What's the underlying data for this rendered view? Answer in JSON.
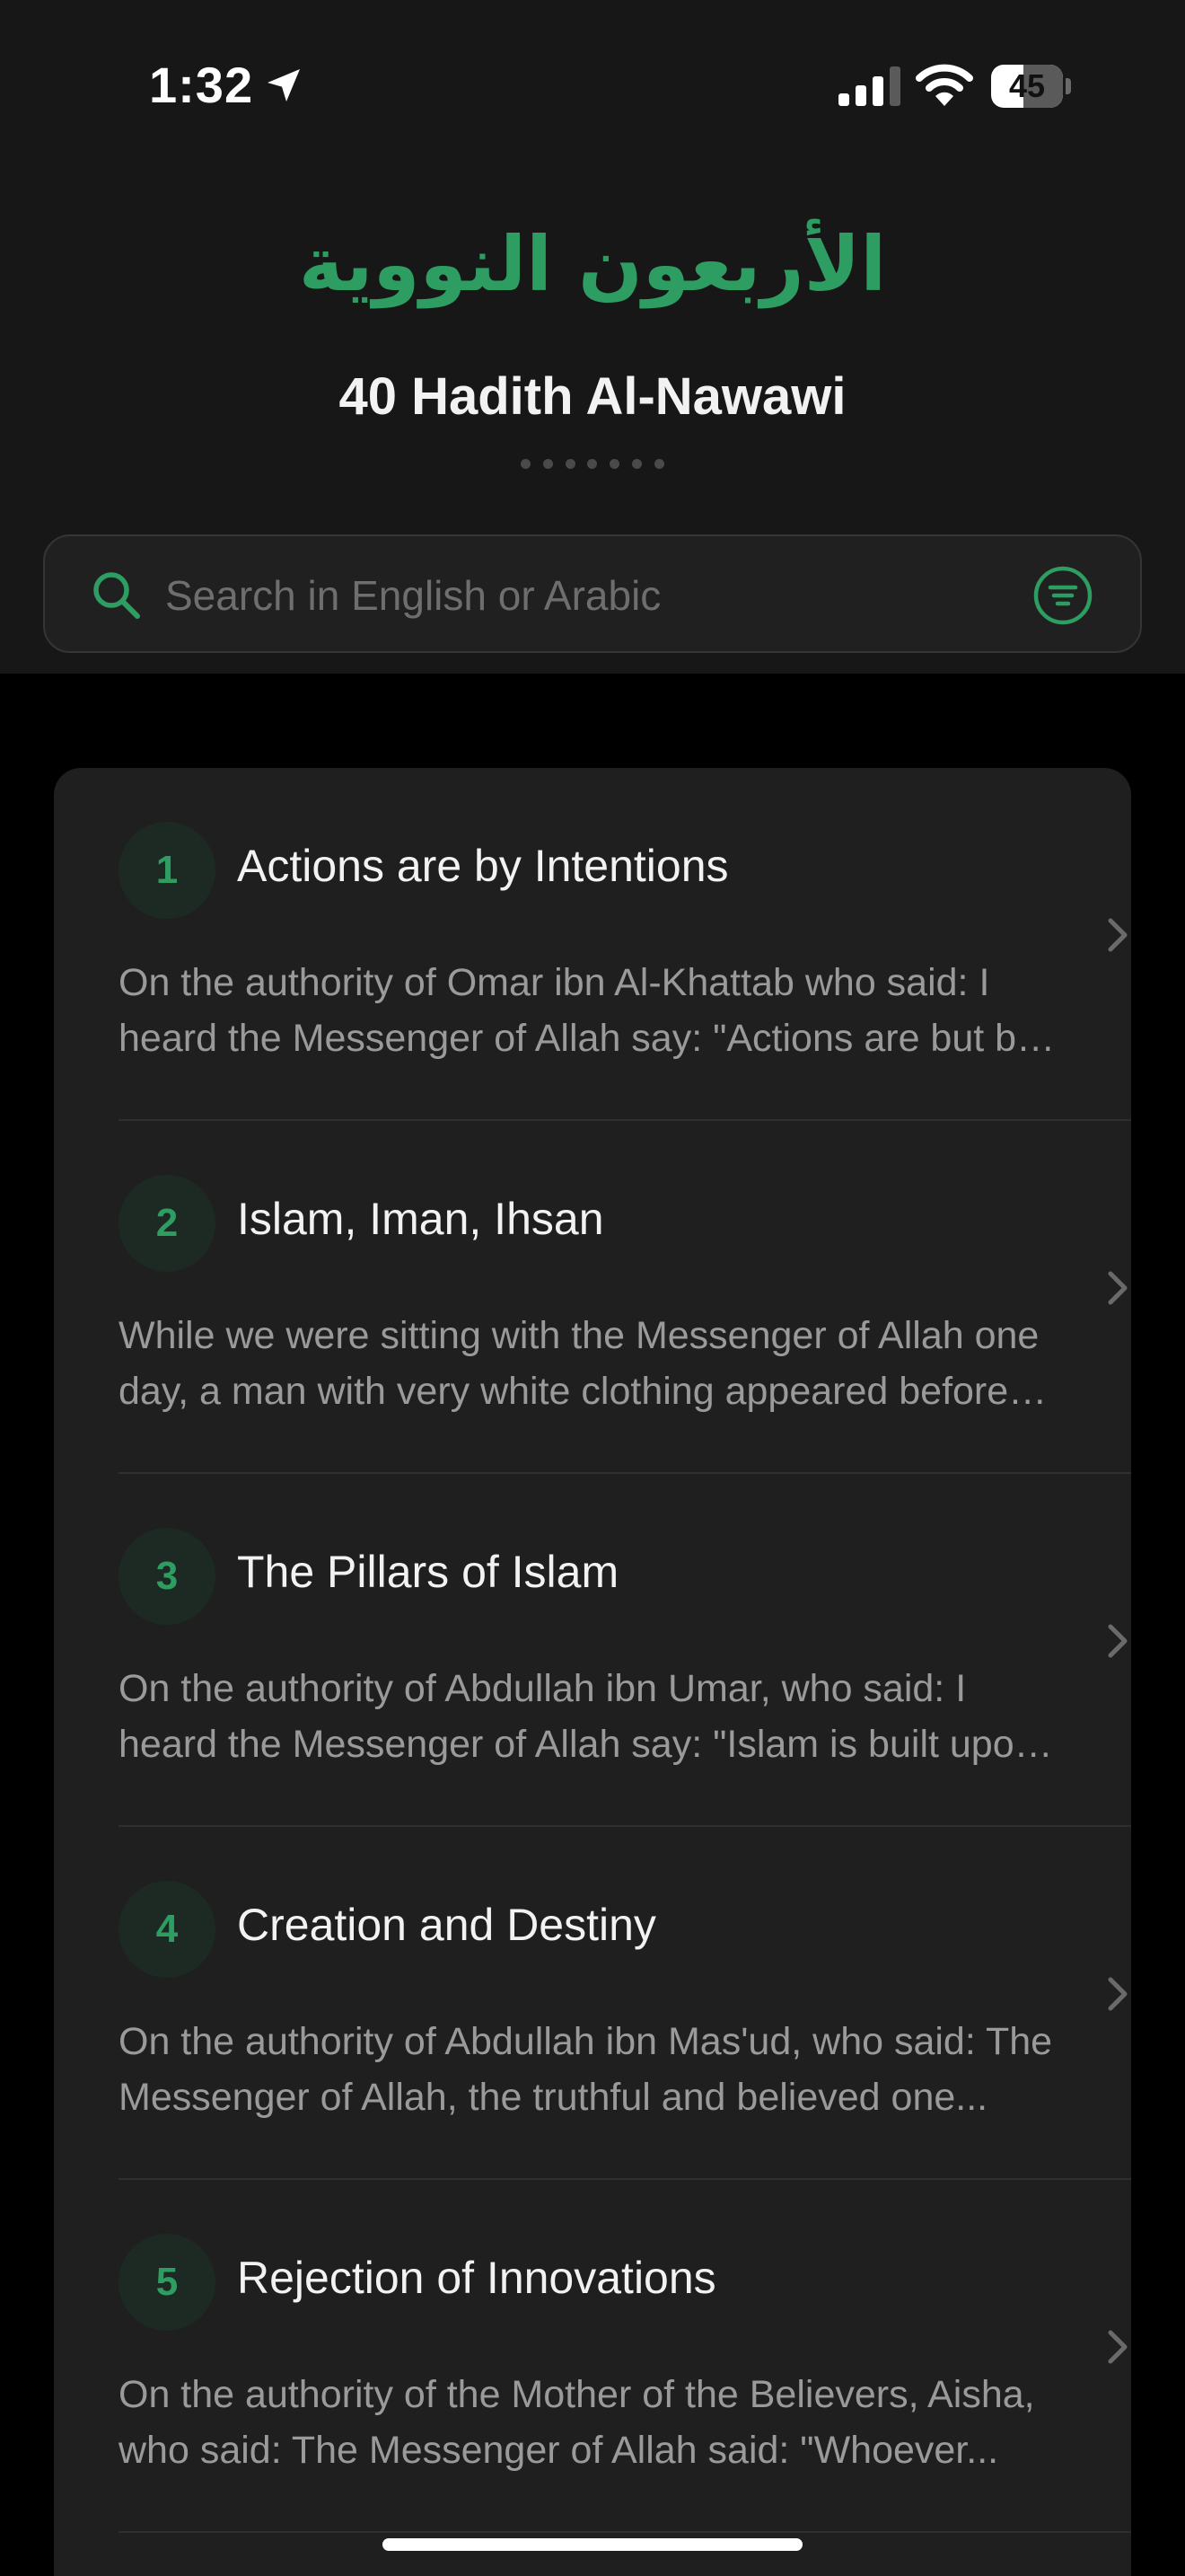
{
  "status_bar": {
    "time": "1:32",
    "battery": "45",
    "battery_level": 0.45
  },
  "header": {
    "arabic_title": "الأربعون النووية",
    "title": "40 Hadith Al-Nawawi",
    "page_dots_count": 7
  },
  "search": {
    "placeholder": "Search in English or Arabic",
    "value": ""
  },
  "icons": {
    "location": "location-arrow-icon",
    "signal": "cellular-signal-icon",
    "wifi": "wifi-icon",
    "search": "search-icon",
    "filter": "filter-icon",
    "chevron": "chevron-right-icon"
  },
  "colors": {
    "accent": "#2e9d62",
    "background": "#000000",
    "header_bg": "#171717",
    "card_bg": "#1f1f1f"
  },
  "hadiths": [
    {
      "number": "1",
      "title": "Actions are by Intentions",
      "excerpt": "On the authority of Omar ibn Al-Khattab who said: I heard the Messenger of Allah say: \"Actions are but by intentions..."
    },
    {
      "number": "2",
      "title": "Islam, Iman, Ihsan",
      "excerpt": "While we were sitting with the Messenger of Allah one day, a man with very white clothing appeared before us..."
    },
    {
      "number": "3",
      "title": "The Pillars of Islam",
      "excerpt": "On the authority of Abdullah ibn Umar, who said: I heard the Messenger of Allah say: \"Islam is built upon five..."
    },
    {
      "number": "4",
      "title": "Creation and Destiny",
      "excerpt": "On the authority of Abdullah ibn Mas'ud, who said: The Messenger of Allah, the truthful and believed one..."
    },
    {
      "number": "5",
      "title": "Rejection of Innovations",
      "excerpt": "On the authority of the Mother of the Believers, Aisha, who said: The Messenger of Allah said: \"Whoever..."
    }
  ]
}
